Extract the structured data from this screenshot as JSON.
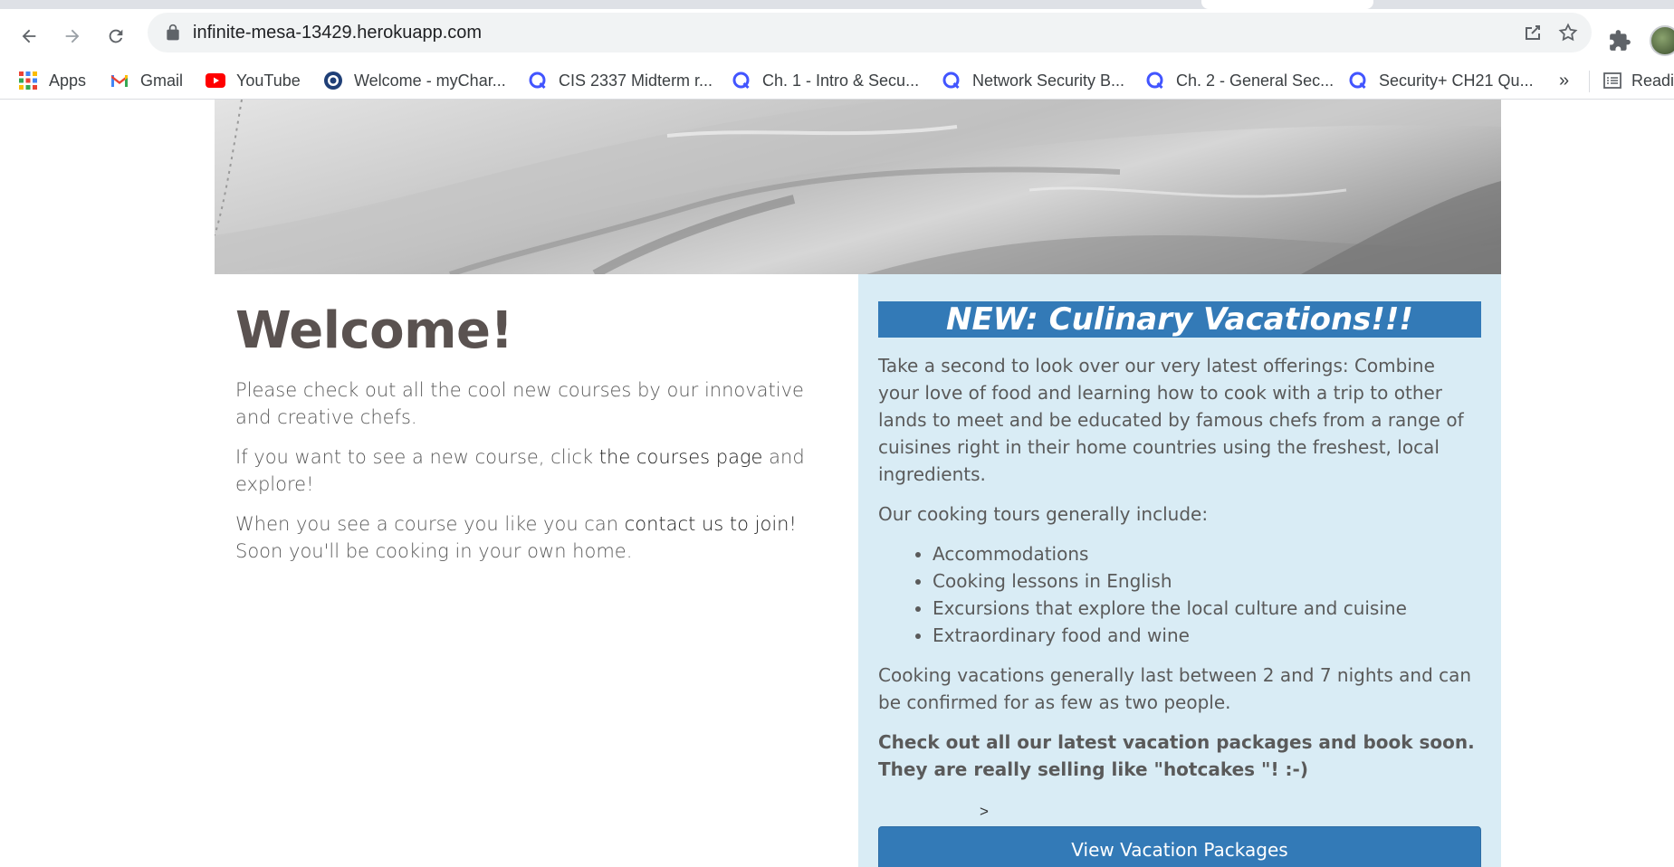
{
  "browser": {
    "url": "infinite-mesa-13429.herokuapp.com",
    "bookmarks": [
      {
        "label": "Apps",
        "icon": "apps-grid-icon"
      },
      {
        "label": "Gmail",
        "icon": "gmail-icon"
      },
      {
        "label": "YouTube",
        "icon": "youtube-icon"
      },
      {
        "label": "Welcome - myChar...",
        "icon": "mychart-icon"
      },
      {
        "label": "CIS 2337 Midterm r...",
        "icon": "quizlet-icon"
      },
      {
        "label": "Ch. 1 - Intro & Secu...",
        "icon": "quizlet-icon"
      },
      {
        "label": "Network Security B...",
        "icon": "quizlet-icon"
      },
      {
        "label": "Ch. 2 - General Sec...",
        "icon": "quizlet-icon"
      },
      {
        "label": "Security+ CH21 Qu...",
        "icon": "quizlet-icon"
      }
    ],
    "more_bookmarks": "»",
    "reading_list": "Readi"
  },
  "welcome": {
    "title": "Welcome!",
    "p1": "Please check out all the cool new courses by our innovative and creative chefs.",
    "p2_before": "If you want to see a new course, click ",
    "p2_link": "the courses page",
    "p2_after": " and explore!",
    "p3_before": "When you see a course you like you can ",
    "p3_link": "contact us to join!",
    "p3_after": " Soon you'll be cooking in your own home."
  },
  "promo": {
    "title": "NEW: Culinary Vacations!!!",
    "intro": "Take a second to look over our very latest offerings: Combine your love of food and learning how to cook with a trip to other lands to meet and be educated by famous chefs from a range of cuisines right in their home countries using the freshest, local ingredients.",
    "tours_intro": "Our cooking tours generally include:",
    "items": [
      "Accommodations",
      "Cooking lessons in English",
      "Excursions that explore the local culture and cuisine",
      "Extraordinary food and wine"
    ],
    "duration": "Cooking vacations generally last between 2 and 7 nights and can be confirmed for as few as two people.",
    "cta_text": "Check out all our latest vacation packages and book soon. They are really selling like \"hotcakes \"! :-)",
    "stray": ">",
    "button_label": "View Vacation Packages"
  },
  "colors": {
    "accent_blue": "#337ab7",
    "promo_background": "#d9ecf5"
  }
}
